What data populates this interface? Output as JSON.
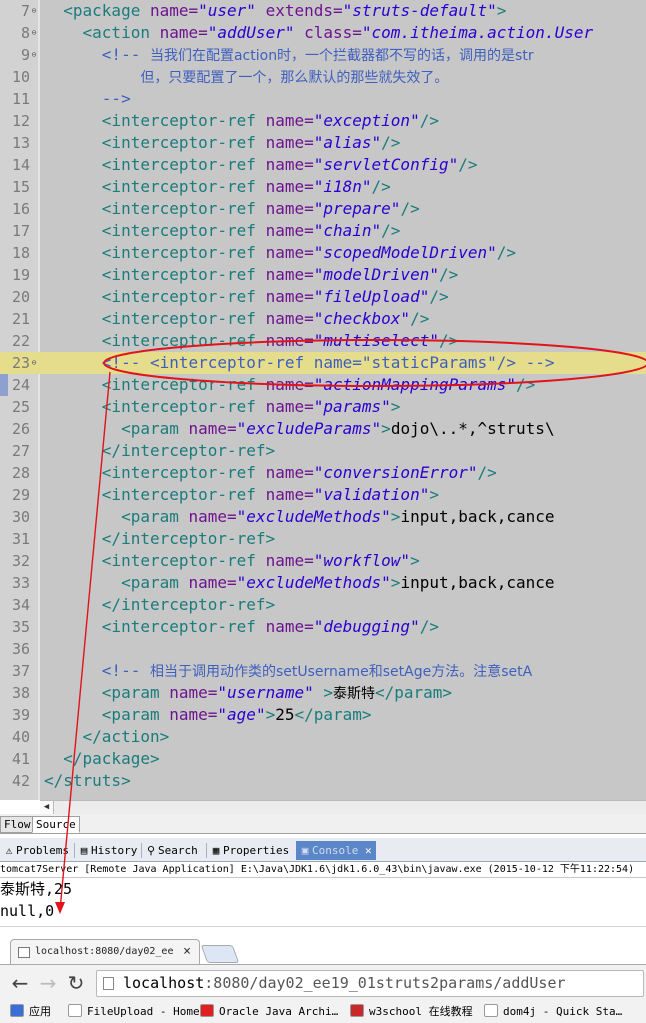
{
  "editor": {
    "lines": [
      {
        "n": "7",
        "fold": "⊖",
        "indent": "  ",
        "tokens": [
          [
            "t",
            "<package "
          ],
          [
            "a",
            "name="
          ],
          [
            "v",
            "\"user\""
          ],
          [
            "a",
            " extends="
          ],
          [
            "v",
            "\"struts-default\""
          ],
          [
            "t",
            ">"
          ]
        ]
      },
      {
        "n": "8",
        "fold": "⊖",
        "indent": "    ",
        "tokens": [
          [
            "t",
            "<action "
          ],
          [
            "a",
            "name="
          ],
          [
            "v",
            "\"addUser\""
          ],
          [
            "a",
            " class="
          ],
          [
            "v",
            "\"com.itheima.action.User"
          ]
        ]
      },
      {
        "n": "9",
        "fold": "⊖",
        "indent": "      ",
        "tokens": [
          [
            "c",
            "<!-- "
          ],
          [
            "c cm",
            "当我们在配置action时，一个拦截器都不写的话，调用的是str"
          ]
        ]
      },
      {
        "n": "10",
        "indent": "          ",
        "tokens": [
          [
            "c cm",
            "但，只要配置了一个，那么默认的那些就失效了。"
          ]
        ]
      },
      {
        "n": "11",
        "indent": "      ",
        "tokens": [
          [
            "c",
            "-->"
          ]
        ]
      },
      {
        "n": "12",
        "indent": "      ",
        "tokens": [
          [
            "t",
            "<interceptor-ref "
          ],
          [
            "a",
            "name="
          ],
          [
            "v",
            "\"exception\""
          ],
          [
            "t",
            "/>"
          ]
        ]
      },
      {
        "n": "13",
        "indent": "      ",
        "tokens": [
          [
            "t",
            "<interceptor-ref "
          ],
          [
            "a",
            "name="
          ],
          [
            "v",
            "\"alias\""
          ],
          [
            "t",
            "/>"
          ]
        ]
      },
      {
        "n": "14",
        "indent": "      ",
        "tokens": [
          [
            "t",
            "<interceptor-ref "
          ],
          [
            "a",
            "name="
          ],
          [
            "v",
            "\"servletConfig\""
          ],
          [
            "t",
            "/>"
          ]
        ]
      },
      {
        "n": "15",
        "indent": "      ",
        "tokens": [
          [
            "t",
            "<interceptor-ref "
          ],
          [
            "a",
            "name="
          ],
          [
            "v",
            "\"i18n\""
          ],
          [
            "t",
            "/>"
          ]
        ]
      },
      {
        "n": "16",
        "indent": "      ",
        "tokens": [
          [
            "t",
            "<interceptor-ref "
          ],
          [
            "a",
            "name="
          ],
          [
            "v",
            "\"prepare\""
          ],
          [
            "t",
            "/>"
          ]
        ]
      },
      {
        "n": "17",
        "indent": "      ",
        "tokens": [
          [
            "t",
            "<interceptor-ref "
          ],
          [
            "a",
            "name="
          ],
          [
            "v",
            "\"chain\""
          ],
          [
            "t",
            "/>"
          ]
        ]
      },
      {
        "n": "18",
        "indent": "      ",
        "tokens": [
          [
            "t",
            "<interceptor-ref "
          ],
          [
            "a",
            "name="
          ],
          [
            "v",
            "\"scopedModelDriven\""
          ],
          [
            "t",
            "/>"
          ]
        ]
      },
      {
        "n": "19",
        "indent": "      ",
        "tokens": [
          [
            "t",
            "<interceptor-ref "
          ],
          [
            "a",
            "name="
          ],
          [
            "v",
            "\"modelDriven\""
          ],
          [
            "t",
            "/>"
          ]
        ]
      },
      {
        "n": "20",
        "indent": "      ",
        "tokens": [
          [
            "t",
            "<interceptor-ref "
          ],
          [
            "a",
            "name="
          ],
          [
            "v",
            "\"fileUpload\""
          ],
          [
            "t",
            "/>"
          ]
        ]
      },
      {
        "n": "21",
        "indent": "      ",
        "tokens": [
          [
            "t",
            "<interceptor-ref "
          ],
          [
            "a",
            "name="
          ],
          [
            "v",
            "\"checkbox\""
          ],
          [
            "t",
            "/>"
          ]
        ]
      },
      {
        "n": "22",
        "indent": "      ",
        "tokens": [
          [
            "t",
            "<interceptor-ref "
          ],
          [
            "a",
            "name="
          ],
          [
            "v",
            "\"multiselect\""
          ],
          [
            "t",
            "/>"
          ]
        ]
      },
      {
        "n": "23",
        "fold": "⊖",
        "indent": "      ",
        "hl": true,
        "tokens": [
          [
            "c",
            "<!-- <interceptor-ref name=\"staticParams\"/> -->"
          ]
        ]
      },
      {
        "n": "24",
        "indent": "      ",
        "tokens": [
          [
            "t",
            "<interceptor-ref "
          ],
          [
            "a",
            "name="
          ],
          [
            "v",
            "\"actionMappingParams\""
          ],
          [
            "t",
            "/>"
          ]
        ]
      },
      {
        "n": "25",
        "indent": "      ",
        "tokens": [
          [
            "t",
            "<interceptor-ref "
          ],
          [
            "a",
            "name="
          ],
          [
            "v",
            "\"params\""
          ],
          [
            "t",
            ">"
          ]
        ]
      },
      {
        "n": "26",
        "indent": "        ",
        "tokens": [
          [
            "t",
            "<param "
          ],
          [
            "a",
            "name="
          ],
          [
            "v",
            "\"excludeParams\""
          ],
          [
            "t",
            ">"
          ],
          [
            "x",
            "dojo\\..*,^struts\\"
          ]
        ]
      },
      {
        "n": "27",
        "indent": "      ",
        "tokens": [
          [
            "t",
            "</interceptor-ref>"
          ]
        ]
      },
      {
        "n": "28",
        "indent": "      ",
        "tokens": [
          [
            "t",
            "<interceptor-ref "
          ],
          [
            "a",
            "name="
          ],
          [
            "v",
            "\"conversionError\""
          ],
          [
            "t",
            "/>"
          ]
        ]
      },
      {
        "n": "29",
        "indent": "      ",
        "tokens": [
          [
            "t",
            "<interceptor-ref "
          ],
          [
            "a",
            "name="
          ],
          [
            "v",
            "\"validation\""
          ],
          [
            "t",
            ">"
          ]
        ]
      },
      {
        "n": "30",
        "indent": "        ",
        "tokens": [
          [
            "t",
            "<param "
          ],
          [
            "a",
            "name="
          ],
          [
            "v",
            "\"excludeMethods\""
          ],
          [
            "t",
            ">"
          ],
          [
            "x",
            "input,back,cance"
          ]
        ]
      },
      {
        "n": "31",
        "indent": "      ",
        "tokens": [
          [
            "t",
            "</interceptor-ref>"
          ]
        ]
      },
      {
        "n": "32",
        "indent": "      ",
        "tokens": [
          [
            "t",
            "<interceptor-ref "
          ],
          [
            "a",
            "name="
          ],
          [
            "v",
            "\"workflow\""
          ],
          [
            "t",
            ">"
          ]
        ]
      },
      {
        "n": "33",
        "indent": "        ",
        "tokens": [
          [
            "t",
            "<param "
          ],
          [
            "a",
            "name="
          ],
          [
            "v",
            "\"excludeMethods\""
          ],
          [
            "t",
            ">"
          ],
          [
            "x",
            "input,back,cance"
          ]
        ]
      },
      {
        "n": "34",
        "indent": "      ",
        "tokens": [
          [
            "t",
            "</interceptor-ref>"
          ]
        ]
      },
      {
        "n": "35",
        "indent": "      ",
        "tokens": [
          [
            "t",
            "<interceptor-ref "
          ],
          [
            "a",
            "name="
          ],
          [
            "v",
            "\"debugging\""
          ],
          [
            "t",
            "/>"
          ]
        ]
      },
      {
        "n": "36",
        "indent": "",
        "tokens": []
      },
      {
        "n": "37",
        "indent": "      ",
        "tokens": [
          [
            "c",
            "<!-- "
          ],
          [
            "c cm",
            "相当于调用动作类的setUsername和setAge方法。注意setA"
          ]
        ]
      },
      {
        "n": "38",
        "indent": "      ",
        "tokens": [
          [
            "t",
            "<param "
          ],
          [
            "a",
            "name="
          ],
          [
            "v",
            "\"username\""
          ],
          [
            "t",
            " >"
          ],
          [
            "x cm",
            "泰斯特"
          ],
          [
            "t",
            "</param>"
          ]
        ]
      },
      {
        "n": "39",
        "indent": "      ",
        "tokens": [
          [
            "t",
            "<param "
          ],
          [
            "a",
            "name="
          ],
          [
            "v",
            "\"age\""
          ],
          [
            "t",
            ">"
          ],
          [
            "x",
            "25"
          ],
          [
            "t",
            "</param>"
          ]
        ]
      },
      {
        "n": "40",
        "indent": "    ",
        "tokens": [
          [
            "t",
            "</action>"
          ]
        ]
      },
      {
        "n": "41",
        "indent": "  ",
        "tokens": [
          [
            "t",
            "</package>"
          ]
        ]
      },
      {
        "n": "42",
        "indent": "",
        "tokens": [
          [
            "t",
            "</struts>"
          ]
        ]
      }
    ],
    "tabs": [
      "Flow",
      "Source"
    ],
    "active_tab": "Source"
  },
  "views": {
    "tabs": [
      {
        "label": "Problems",
        "icon": "⚠"
      },
      {
        "label": "History",
        "icon": "▤"
      },
      {
        "label": "Search",
        "icon": "⚲"
      },
      {
        "label": "Properties",
        "icon": "▦"
      },
      {
        "label": "Console",
        "icon": "▣"
      }
    ],
    "active": "Console",
    "close_glyph": "✕"
  },
  "console": {
    "title": "tomcat7Server [Remote Java Application] E:\\Java\\JDK1.6\\jdk1.6.0_43\\bin\\javaw.exe (2015-10-12 下午11:22:54)",
    "output": [
      "泰斯特,25",
      "null,0"
    ]
  },
  "browser": {
    "tab_title": "localhost:8080/day02_ee",
    "tab_close": "×",
    "url_host": "localhost",
    "url_path": ":8080/day02_ee19_01struts2params/addUser",
    "nav": {
      "back": "←",
      "forward": "→",
      "reload": "↻"
    },
    "bookmarks": [
      {
        "label": "应用",
        "icon_color": "#3a6fd8"
      },
      {
        "label": "FileUpload - Home",
        "icon_color": "#ffffff"
      },
      {
        "label": "Oracle Java Archi…",
        "icon_color": "#e02020"
      },
      {
        "label": "w3school 在线教程",
        "icon_color": "#c82828"
      },
      {
        "label": "dom4j - Quick Sta…",
        "icon_color": "#ffffff"
      }
    ]
  }
}
